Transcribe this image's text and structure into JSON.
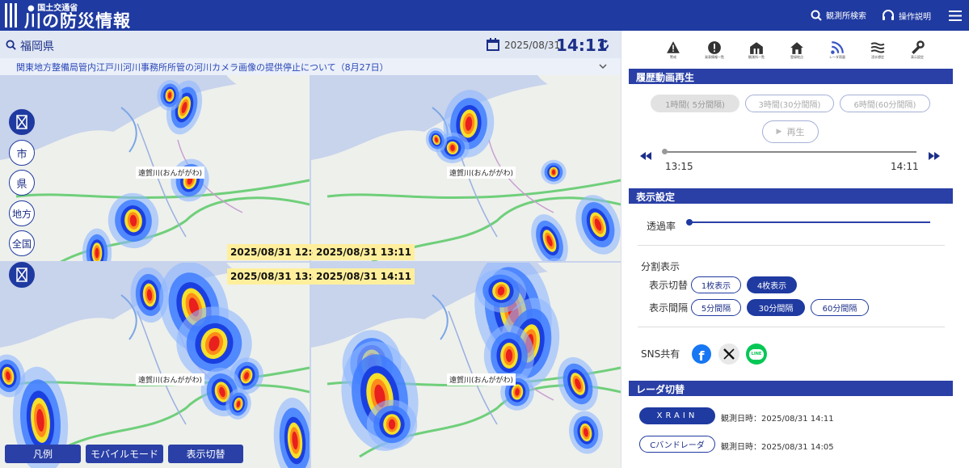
{
  "header": {
    "ministry": "国土交通省",
    "title": "川の防災情報",
    "search_label": "観測所検索",
    "help_label": "操作説明"
  },
  "status": {
    "prefecture": "福岡県",
    "date": "2025/08/31",
    "time": "14:11"
  },
  "notice": "関東地方整備局管内江戸川河川事務所所管の河川カメラ画像の提供停止について（8月27日）",
  "river_label": "遠賀川(おんががわ)",
  "panels": [
    {
      "time": "2025/08/31 12:41"
    },
    {
      "time": "2025/08/31 13:11"
    },
    {
      "time": "2025/08/31 13:41"
    },
    {
      "time": "2025/08/31 14:11"
    }
  ],
  "left_controls": [
    "市",
    "県",
    "地方",
    "全国"
  ],
  "bottom_buttons": [
    "凡例",
    "モバイルモード",
    "表示切替"
  ],
  "icons": [
    {
      "name": "warning-icon",
      "label": "警戒"
    },
    {
      "name": "alert-icon",
      "label": "発表情報一覧"
    },
    {
      "name": "station-list-icon",
      "label": "観測所一覧"
    },
    {
      "name": "home-icon",
      "label": "登録地点"
    },
    {
      "name": "radar-icon",
      "label": "レーダ雨量"
    },
    {
      "name": "flood-icon",
      "label": "浸水想定"
    },
    {
      "name": "settings-icon",
      "label": "表示設定"
    }
  ],
  "history": {
    "title": "履歴動画再生",
    "ranges": [
      "1時間( 5分間隔)",
      "3時間(30分間隔)",
      "6時間(60分間隔)"
    ],
    "play_label": "再生",
    "start_time": "13:15",
    "end_time": "14:11"
  },
  "display": {
    "title": "表示設定",
    "opacity_label": "透過率",
    "split_label": "分割表示",
    "mode_label": "表示切替",
    "modes": [
      "1枚表示",
      "4枚表示"
    ],
    "interval_label": "表示間隔",
    "intervals": [
      "5分間隔",
      "30分間隔",
      "60分間隔"
    ],
    "sns_label": "SNS共有"
  },
  "radar": {
    "title": "レーダ切替",
    "items": [
      {
        "name": "XRAIN",
        "obs": "観測日時：2025/08/31 14:11"
      },
      {
        "name": "Cバンドレーダ",
        "obs": "観測日時：2025/08/31 14:05"
      }
    ]
  },
  "colors": {
    "primary": "#1f3aa0",
    "sea": "#c8d3ec",
    "stamp": "#ffef9c"
  }
}
